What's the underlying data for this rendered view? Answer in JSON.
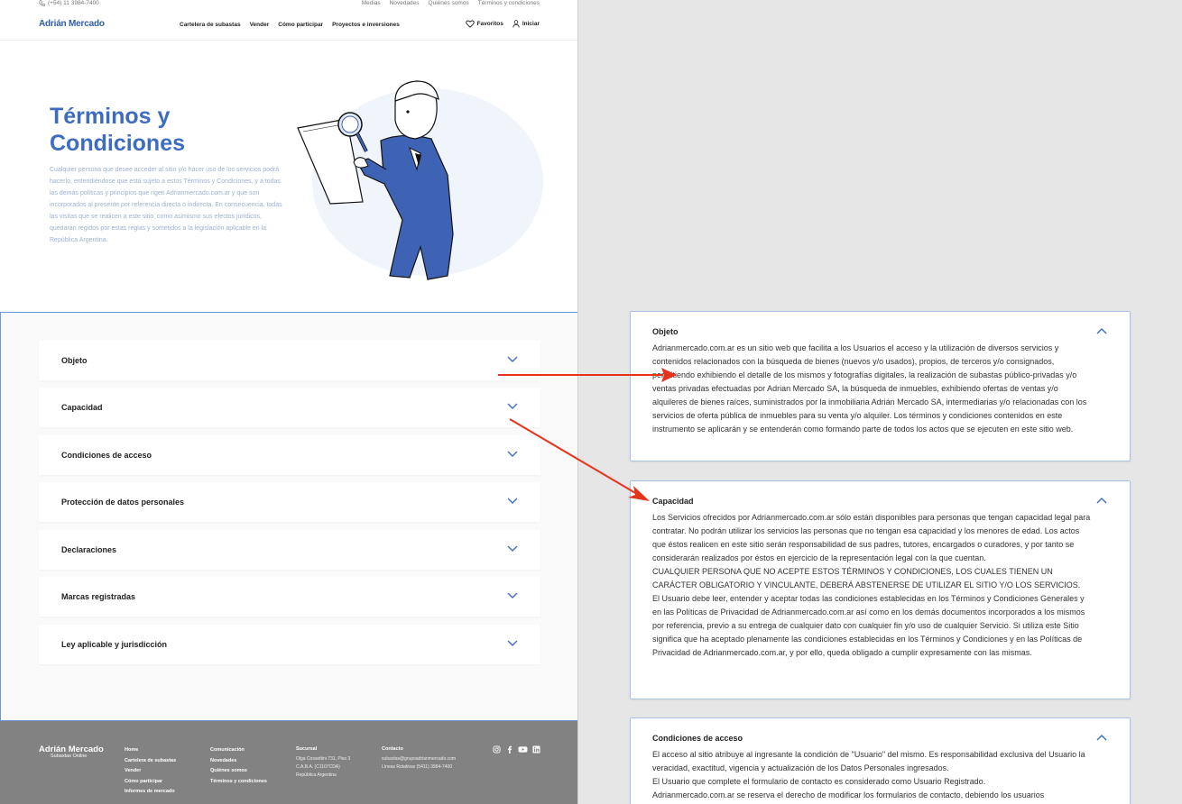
{
  "topbar": {
    "phone": "(+54) 11 3984-7400",
    "links": [
      "Medias",
      "Novedades",
      "Quiénes somos",
      "Términos y condiciones"
    ]
  },
  "header": {
    "logo": "Adrián Mercado",
    "nav": [
      "Cartelera de subastas",
      "Vender",
      "Cómo participar",
      "Proyectos e inversiones"
    ],
    "favorites": "Favoritos",
    "login": "Iniciar"
  },
  "hero": {
    "title": "Términos y Condiciones",
    "text": "Cualquier persona que desee acceder al sitio y/o hacer uso de los servicios podrá hacerlo, entendiéndose que está sujeto a estos Términos y Condiciones, y a todas las demás políticas y principios que rigen Adrianmercado.com.ar y que son incorporados al presente por referencia directa o indirecta. En consecuencia, todas las visitas que se realicen a este sitio, como asimismo sus efectos jurídicos, quedarán regidos por estas reglas y sometidos a la legislación aplicable en la República Argentina."
  },
  "accordion": [
    "Objeto",
    "Capacidad",
    "Condiciones de acceso",
    "Protección de datos personales",
    "Declaraciones",
    "Marcas registradas",
    "Ley aplicable y jurisdicción"
  ],
  "footer": {
    "logo": "Adrián Mercado",
    "sub": "Subastas Online",
    "col1": [
      "Home",
      "Cartelera de subastas",
      "Vender",
      "Cómo participar",
      "Informes de mercado"
    ],
    "col2": [
      "Comunicación",
      "Novedades",
      "Quiénes somos",
      "Términos y condiciones"
    ],
    "sucursal": {
      "heading": "Sucursal",
      "lines": [
        "Olga Cossettini 731, Piso 3",
        "C.A.B.A. (C1107CDA)",
        "República Argentina"
      ]
    },
    "contacto": {
      "heading": "Contacto",
      "lines": [
        "subastas@grupoadrianmercado.com",
        "Líneas Rotativas (5411) 3984-7400"
      ]
    }
  },
  "panels": {
    "objeto": {
      "title": "Objeto",
      "paragraphs": [
        "Adrianmercado.com.ar es un sitio web que facilita a los Usuarios el acceso y la utilización de diversos servicios y contenidos relacionados con la búsqueda de bienes (nuevos y/o usados), propios, de terceros y/o consignados, permitiendo exhibiendo el detalle de los mismos y fotografías digitales, la realización de subastas público-privadas y/o ventas privadas efectuadas por Adrian Mercado SA, la búsqueda de inmuebles, exhibiendo ofertas de ventas y/o alquileres de bienes raíces, suministrados por la inmobiliaria Adrián Mercado SA, intermediarias y/o relacionadas con los servicios de oferta pública de inmuebles para su venta y/o alquiler. Los términos y condiciones contenidos en este instrumento se aplicarán y se entenderán como formando parte de todos los actos que se ejecuten en este sitio web."
      ]
    },
    "capacidad": {
      "title": "Capacidad",
      "paragraphs": [
        "Los Servicios ofrecidos por Adrianmercado.com.ar sólo están disponibles para personas que tengan capacidad legal para contratar. No podrán utilizar los servicios las personas que no tengan esa capacidad y los menores de edad. Los actos que éstos realicen en este sitio serán responsabilidad de sus padres, tutores, encargados o curadores, y por tanto se considerarán realizados por éstos en ejercicio de la representación legal con la que cuentan.",
        "CUALQUIER PERSONA QUE NO ACEPTE ESTOS TÉRMINOS Y CONDICIONES, LOS CUALES TIENEN UN CARÁCTER OBLIGATORIO Y VINCULANTE, DEBERÁ ABSTENERSE DE UTILIZAR EL SITIO Y/O LOS SERVICIOS.",
        "El Usuario debe leer, entender y aceptar todas las condiciones establecidas en los Términos y Condiciones Generales y en las Políticas de Privacidad de Adrianmercado.com.ar así como en los demás documentos incorporados a los mismos por referencia, previo a su entrega de cualquier dato con cualquier fin y/o uso de cualquier Servicio. Si utiliza este Sitio significa que ha aceptado plenamente las condiciones establecidas en los Términos y Condiciones y en las Políticas de Privacidad de Adrianmercado.com.ar, y por ello, queda obligado a cumplir expresamente con las mismas."
      ]
    },
    "acceso": {
      "title": "Condiciones de acceso",
      "paragraphs": [
        "El acceso al sitio atribuye al ingresante la condición de \"Usuario\" del mismo. Es responsabilidad exclusiva del Usuario la veracidad, exactitud, vigencia y actualización de los Datos Personales ingresados.",
        "El Usuario que complete el formulario de contacto es considerado como Usuario Registrado.",
        "Adrianmercado.com.ar se reserva el derecho de modificar los formularios de contacto, debiendo los usuarios"
      ]
    }
  },
  "colors": {
    "brand": "#2f5dab",
    "hero_title": "#3d6cc0",
    "accent_border": "#6c97d0",
    "chevron": "#3d6cc0",
    "arrow": "#e8331c",
    "footer_bg": "#828282"
  }
}
